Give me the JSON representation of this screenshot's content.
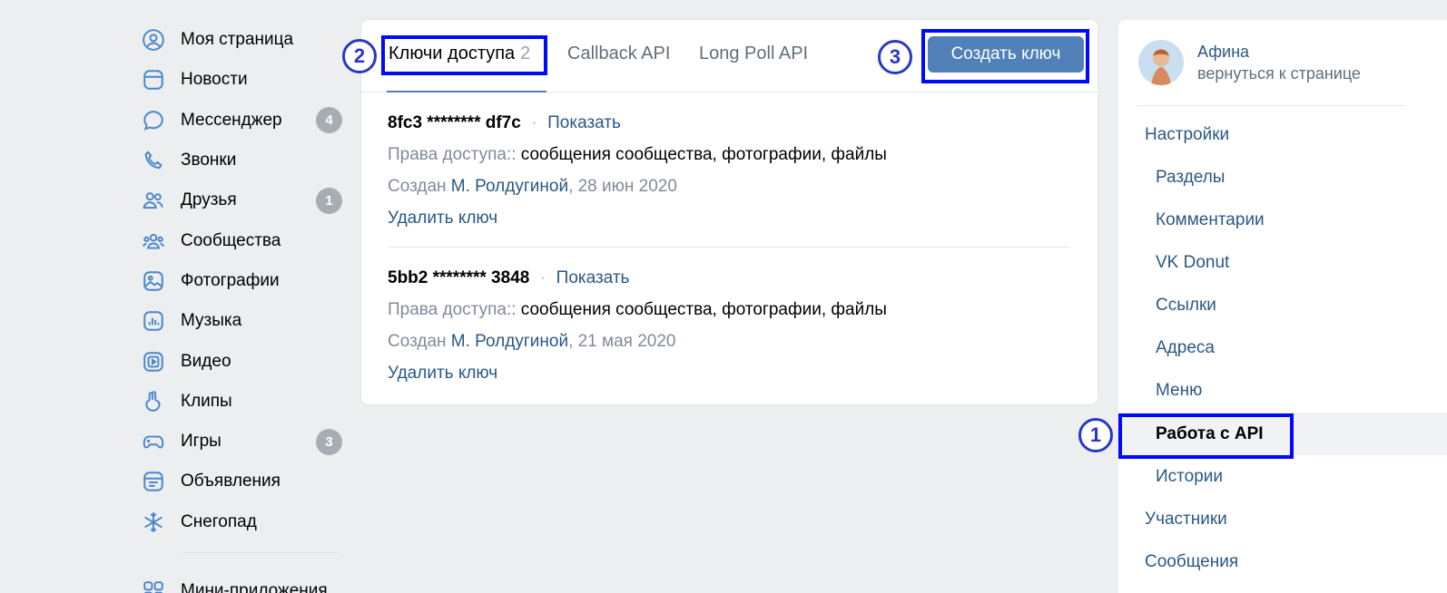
{
  "left_nav": {
    "items": [
      {
        "label": "Моя страница",
        "icon": "user-circle-icon"
      },
      {
        "label": "Новости",
        "icon": "news-icon"
      },
      {
        "label": "Мессенджер",
        "icon": "message-bubble-icon",
        "badge": "4"
      },
      {
        "label": "Звонки",
        "icon": "phone-icon"
      },
      {
        "label": "Друзья",
        "icon": "friends-icon",
        "badge": "1"
      },
      {
        "label": "Сообщества",
        "icon": "communities-icon"
      },
      {
        "label": "Фотографии",
        "icon": "photo-icon"
      },
      {
        "label": "Музыка",
        "icon": "music-icon"
      },
      {
        "label": "Видео",
        "icon": "video-icon"
      },
      {
        "label": "Клипы",
        "icon": "clips-icon"
      },
      {
        "label": "Игры",
        "icon": "gamepad-icon",
        "badge": "3"
      },
      {
        "label": "Объявления",
        "icon": "classifieds-icon"
      },
      {
        "label": "Снегопад",
        "icon": "snowflake-icon"
      }
    ],
    "more_label": "Мини-приложения"
  },
  "tabs": {
    "access_keys": {
      "label": "Ключи доступа",
      "count": "2"
    },
    "callback": {
      "label": "Callback API"
    },
    "longpoll": {
      "label": "Long Poll API"
    }
  },
  "create_button": "Создать ключ",
  "keys": [
    {
      "id": "8fc3 ******** df7c",
      "show": "Показать",
      "rights_label": "Права доступа::",
      "rights_value": "сообщения сообщества, фотографии, файлы",
      "created_label": "Создан",
      "created_by": "М. Ролдугиной",
      "created_date": ", 28 июн 2020",
      "delete": "Удалить ключ"
    },
    {
      "id": "5bb2 ******** 3848",
      "show": "Показать",
      "rights_label": "Права доступа::",
      "rights_value": "сообщения сообщества, фотографии, файлы",
      "created_label": "Создан",
      "created_by": "М. Ролдугиной",
      "created_date": ", 21 мая 2020",
      "delete": "Удалить ключ"
    }
  ],
  "right": {
    "user_name": "Афина",
    "back_link": "вернуться к странице",
    "menu": {
      "settings": "Настройки",
      "sections": "Разделы",
      "comments": "Комментарии",
      "donut": "VK Donut",
      "links": "Ссылки",
      "addresses": "Адреса",
      "menu": "Меню",
      "api": "Работа с API",
      "stories": "Истории",
      "members": "Участники",
      "messages": "Сообщения"
    }
  },
  "annotations": {
    "one": "1",
    "two": "2",
    "three": "3"
  },
  "colors": {
    "accent": "#5181b8",
    "highlight": "#0008ff",
    "link": "#2a5885"
  }
}
